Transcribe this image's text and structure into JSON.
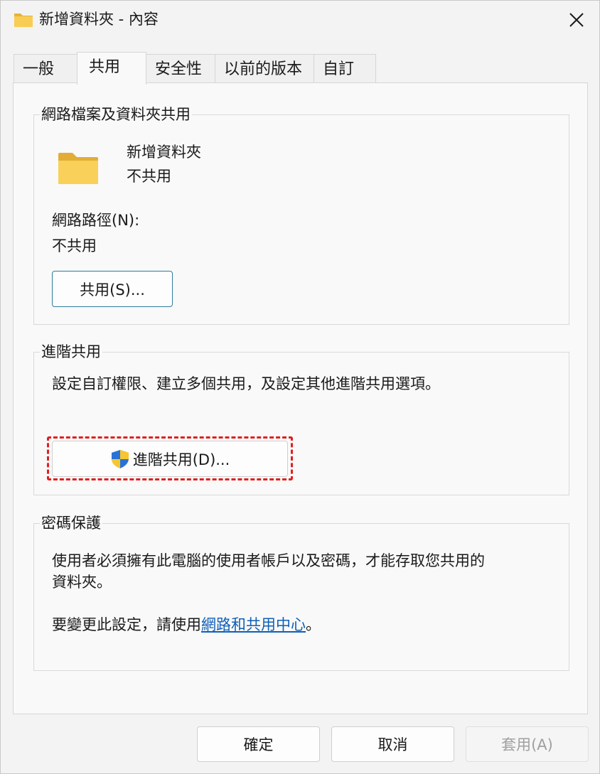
{
  "window": {
    "title": "新增資料夾 - 內容"
  },
  "tabs": [
    {
      "label": "一般"
    },
    {
      "label": "共用"
    },
    {
      "label": "安全性"
    },
    {
      "label": "以前的版本"
    },
    {
      "label": "自訂"
    }
  ],
  "network_sharing": {
    "group_label": "網路檔案及資料夾共用",
    "folder_name": "新增資料夾",
    "folder_status": "不共用",
    "path_label": "網路路徑(N):",
    "path_value": "不共用",
    "share_button": "共用(S)..."
  },
  "advanced_sharing": {
    "group_label": "進階共用",
    "description": "設定自訂權限、建立多個共用，及設定其他進階共用選項。",
    "button": "進階共用(D)..."
  },
  "password_protection": {
    "group_label": "密碼保護",
    "line1": "使用者必須擁有此電腦的使用者帳戶以及密碼，才能存取您共用的",
    "line2": "資料夾。",
    "change_prefix": "要變更此設定，請使用",
    "change_link": "網路和共用中心",
    "change_suffix": "。"
  },
  "footer": {
    "ok": "確定",
    "cancel": "取消",
    "apply": "套用(A)"
  },
  "colors": {
    "folder": "#f6c64a",
    "highlight": "#e02020",
    "link": "#0f5fb8",
    "share_button_border": "#2d7d9a"
  },
  "icons": {
    "title": "folder-icon",
    "close": "close-icon",
    "folder": "folder-icon",
    "shield": "uac-shield-icon"
  }
}
